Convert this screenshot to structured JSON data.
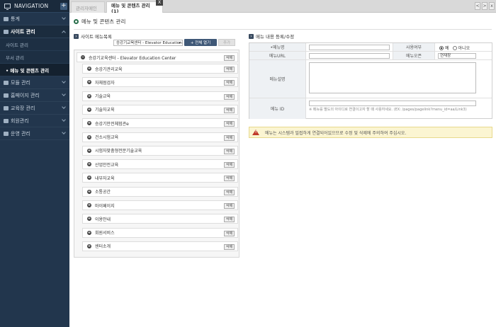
{
  "sidebar": {
    "title": "NAVIGATION",
    "plus": "+",
    "menus": [
      {
        "label": "통계",
        "icon": "monitor-icon"
      },
      {
        "label": "사이트 관리",
        "icon": "home-icon"
      },
      {
        "label": "모듈 관리",
        "icon": "edit-icon"
      },
      {
        "label": "홈페이지 관리",
        "icon": "home-icon"
      },
      {
        "label": "교육장 관리",
        "icon": "table-icon"
      },
      {
        "label": "회원관리",
        "icon": "user-icon"
      },
      {
        "label": "운영 관리",
        "icon": "gear-icon"
      }
    ],
    "submenus": [
      "사이트 관리",
      "부서 관리",
      "• 메뉴 및 콘텐츠 관리"
    ]
  },
  "tabs": {
    "home": "관리자메인",
    "active": "메뉴 및 콘텐츠 관리 (1)",
    "close": "X",
    "win": [
      "<",
      ">",
      "x"
    ]
  },
  "page": {
    "title": "메뉴 및 콘텐츠 관리"
  },
  "tree": {
    "section_title": "사이트 메뉴목록",
    "select_value": "승강기교육센터 - Elevator Education ...",
    "expand_label": "+ 전체 열기",
    "add_label": "추가",
    "delete_label": "삭제",
    "root": "승강기교육센터 - Elevator Education Center",
    "items": [
      "승강기관리교육",
      "자체점검자",
      "기술교육",
      "기술자교육",
      "승강기안전체험관e",
      "건소시험교육",
      "시험자맞춤형전문기술교육",
      "산업안전교육",
      "내부자교육",
      "소통공간",
      "마이페이지",
      "이용안내",
      "회원서비스",
      "센터소개"
    ]
  },
  "form": {
    "section_title": "메뉴 내용 등록/수정",
    "menu_name": "•메뉴명",
    "usage": "사용여부",
    "yes": "예",
    "no": "아니오",
    "menu_url": "메뉴URL",
    "menu_open": "메뉴오픈",
    "open_value": "현재창",
    "menu_desc": "메뉴설명",
    "menu_id": "메뉴 ID",
    "id_help": "※ 메뉴를 별도의 아이디로 연결이고자 할 때 사용하세요. (EX: /pages/pagelink?menu_id=aa/Link3)"
  },
  "notice": "메뉴는 시스템과 밀접하게 연결되어있으므로 수정 및 삭제에 주의하여 주십시오."
}
